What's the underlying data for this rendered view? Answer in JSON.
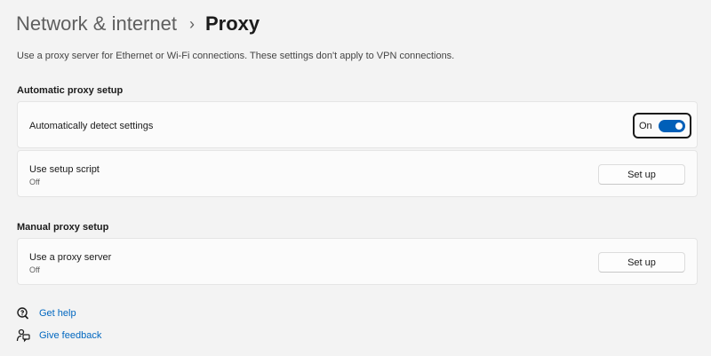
{
  "breadcrumb": {
    "parent": "Network & internet",
    "separator": "›",
    "current": "Proxy"
  },
  "description": "Use a proxy server for Ethernet or Wi-Fi connections. These settings don't apply to VPN connections.",
  "automatic": {
    "section_title": "Automatic proxy setup",
    "detect": {
      "title": "Automatically detect settings",
      "toggle_label": "On",
      "toggle_on": true
    },
    "script": {
      "title": "Use setup script",
      "subtitle": "Off",
      "button_label": "Set up"
    }
  },
  "manual": {
    "section_title": "Manual proxy setup",
    "server": {
      "title": "Use a proxy server",
      "subtitle": "Off",
      "button_label": "Set up"
    }
  },
  "links": {
    "help": {
      "label": "Get help",
      "icon": "help-icon"
    },
    "feedback": {
      "label": "Give feedback",
      "icon": "feedback-icon"
    }
  },
  "colors": {
    "accent": "#005fb8",
    "link": "#0067c0",
    "background": "#f3f3f3",
    "card": "#fbfbfb"
  }
}
